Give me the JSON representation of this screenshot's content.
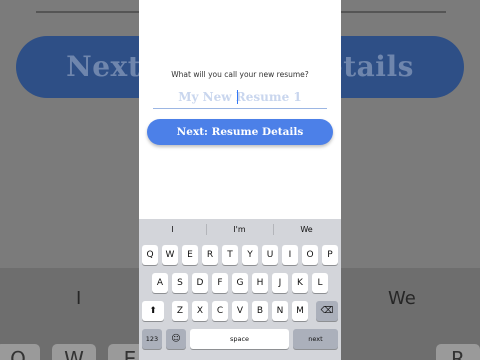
{
  "background": {
    "button_label": "Next: Resume Details",
    "suggestions": [
      "I",
      "We"
    ],
    "keys": [
      "Q",
      "W",
      "E",
      "R"
    ]
  },
  "form": {
    "prompt": "What will you call your new resume?",
    "input_value": "",
    "input_placeholder": "My New Resume 1",
    "next_button": "Next: Resume Details"
  },
  "keyboard": {
    "suggestions": [
      "I",
      "I'm",
      "We"
    ],
    "row1": [
      "Q",
      "W",
      "E",
      "R",
      "T",
      "Y",
      "U",
      "I",
      "O",
      "P"
    ],
    "row2": [
      "A",
      "S",
      "D",
      "F",
      "G",
      "H",
      "J",
      "K",
      "L"
    ],
    "row3": [
      "Z",
      "X",
      "C",
      "V",
      "B",
      "N",
      "M"
    ],
    "shift_symbol": "⬆",
    "backspace_symbol": "⌫",
    "numbers_key": "123",
    "emoji_symbol": "☺",
    "space_key": "space",
    "next_key": "next"
  },
  "colors": {
    "accent": "#4c80e8",
    "keyboard_bg": "#d3d5da"
  }
}
